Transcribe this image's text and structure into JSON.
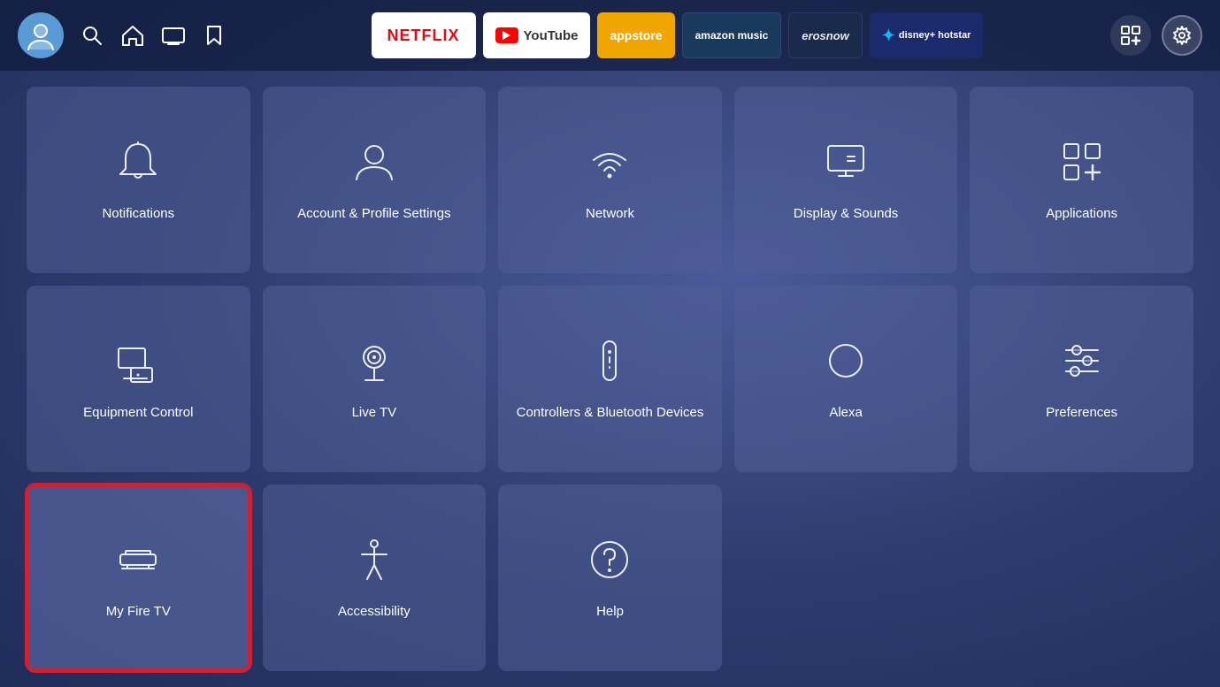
{
  "header": {
    "apps": [
      {
        "id": "netflix",
        "label": "NETFLIX"
      },
      {
        "id": "youtube",
        "label": "YouTube"
      },
      {
        "id": "appstore",
        "label": "appstore"
      },
      {
        "id": "amazon-music",
        "label": "amazon music"
      },
      {
        "id": "erosnow",
        "label": "erosnow"
      },
      {
        "id": "hotstar",
        "label": "disney+ hotstar"
      }
    ]
  },
  "tiles": [
    {
      "id": "notifications",
      "label": "Notifications",
      "icon": "bell"
    },
    {
      "id": "account-profile",
      "label": "Account & Profile Settings",
      "icon": "user"
    },
    {
      "id": "network",
      "label": "Network",
      "icon": "wifi"
    },
    {
      "id": "display-sounds",
      "label": "Display & Sounds",
      "icon": "monitor"
    },
    {
      "id": "applications",
      "label": "Applications",
      "icon": "apps"
    },
    {
      "id": "equipment-control",
      "label": "Equipment Control",
      "icon": "tv-monitor"
    },
    {
      "id": "live-tv",
      "label": "Live TV",
      "icon": "antenna"
    },
    {
      "id": "controllers-bluetooth",
      "label": "Controllers & Bluetooth Devices",
      "icon": "remote"
    },
    {
      "id": "alexa",
      "label": "Alexa",
      "icon": "alexa"
    },
    {
      "id": "preferences",
      "label": "Preferences",
      "icon": "sliders"
    },
    {
      "id": "my-fire-tv",
      "label": "My Fire TV",
      "icon": "firetv",
      "selected": true
    },
    {
      "id": "accessibility",
      "label": "Accessibility",
      "icon": "accessibility"
    },
    {
      "id": "help",
      "label": "Help",
      "icon": "help"
    }
  ]
}
